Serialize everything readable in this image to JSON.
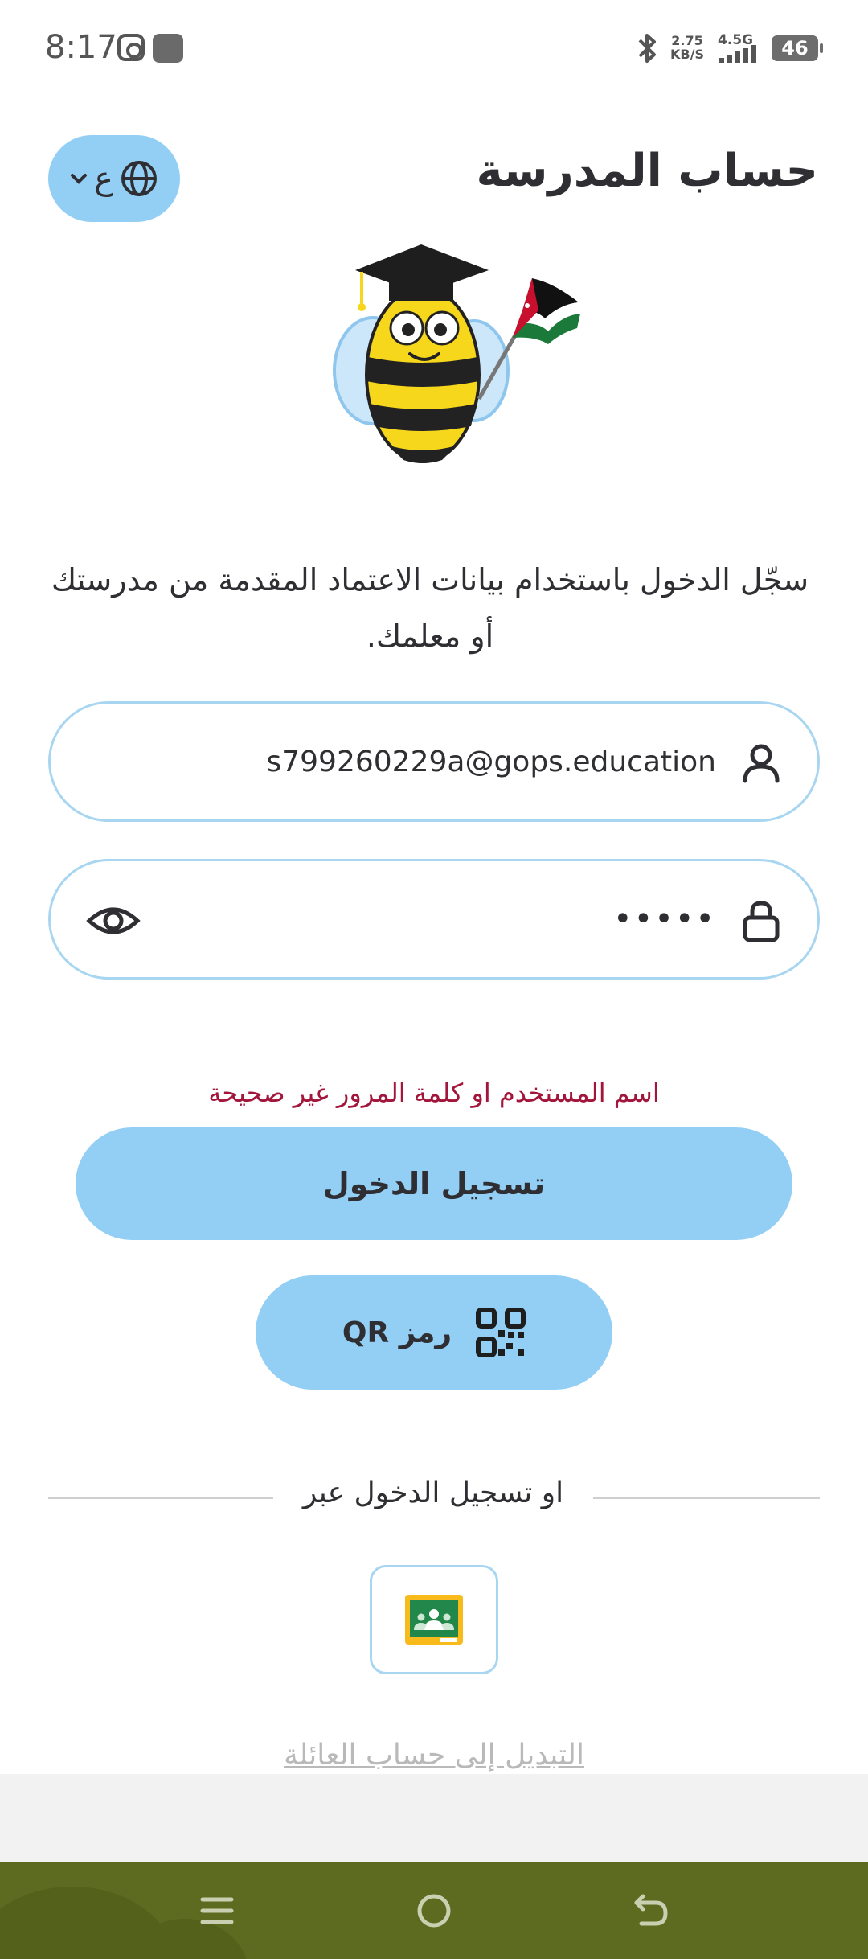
{
  "status_bar": {
    "time": "8:17",
    "net_speed_value": "2.75",
    "net_speed_unit": "KB/S",
    "network_gen": "4.5G",
    "battery": "46",
    "icons": [
      "instagram-icon",
      "app-icon",
      "bluetooth-icon",
      "signal-icon",
      "battery-icon"
    ]
  },
  "header": {
    "title": "حساب المدرسة",
    "language_label": "ع",
    "icons": [
      "globe-icon",
      "chevron-down-icon"
    ]
  },
  "mascot": {
    "icon": "bee-graduate-mascot"
  },
  "instructions": "سجّل الدخول باستخدام بيانات الاعتماد المقدمة من مدرستك أو معلمك.",
  "form": {
    "username_value": "s799260229a@gops.education",
    "password_value": "•••••",
    "error": "اسم المستخدم او كلمة المرور غير صحيحة",
    "login_label": "تسجيل الدخول",
    "qr_label": "رمز QR"
  },
  "alt_login": {
    "divider_text": "او تسجيل الدخول عبر",
    "provider": "google-classroom-icon"
  },
  "switch_link": "التبديل إلى حساب العائلة",
  "colors": {
    "accent": "#93cff5",
    "input_border": "#a8d6f1",
    "error": "#a3163b",
    "text": "#2f2f33",
    "nav_bar": "#5c6b1f"
  }
}
